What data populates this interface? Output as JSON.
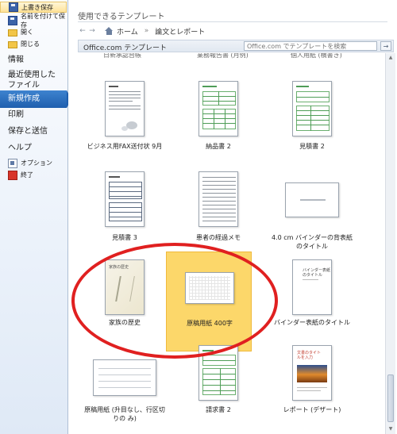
{
  "sidebar": {
    "save": "上書き保存",
    "save_as": "名前を付けて保存",
    "open": "開く",
    "close": "閉じる",
    "info": "情報",
    "recent": "最近使用した\nファイル",
    "new": "新規作成",
    "print": "印刷",
    "share": "保存と送信",
    "help": "ヘルプ",
    "options": "オプション",
    "exit": "終了"
  },
  "main": {
    "section_title": "使用できるテンプレート",
    "nav": {
      "back": "←",
      "forward": "→",
      "home": "ホーム",
      "separator": "»",
      "crumb": "論文とレポート"
    },
    "search": {
      "label": "Office.com テンプレート",
      "placeholder": "Office.com でテンプレートを検索",
      "go": "→"
    },
    "partial_labels": [
      "日新承認台帳",
      "業務報告書 (月例)",
      "個人用紙 (横書き)"
    ]
  },
  "templates": [
    {
      "name": "ビジネス用FAX送付状 9月"
    },
    {
      "name": "納品書 2"
    },
    {
      "name": "見積書 2"
    },
    {
      "name": "見積書 3"
    },
    {
      "name": "患者の経過メモ"
    },
    {
      "name": "4.0 cm バインダーの背表紙のタイトル"
    },
    {
      "name": "家族の歴史"
    },
    {
      "name": "原稿用紙 400字"
    },
    {
      "name": "バインダー表紙のタイトル"
    },
    {
      "name": "原稿用紙 (升目なし、行区切りの み)"
    },
    {
      "name": "請求書 2"
    },
    {
      "name": "レポート (デザート)"
    }
  ],
  "thumb_text": {
    "family": "家族の歴史",
    "binder": "バインダー表紙\nのタイトル",
    "report_title": "文書のタイト\nルを入力"
  },
  "selected_template": "原稿用紙 400字",
  "colors": {
    "highlight": "#fcd76a",
    "annotation_circle": "#e02020",
    "sidebar_active": "#1f5fae",
    "form_lines": "#4f9d57"
  }
}
